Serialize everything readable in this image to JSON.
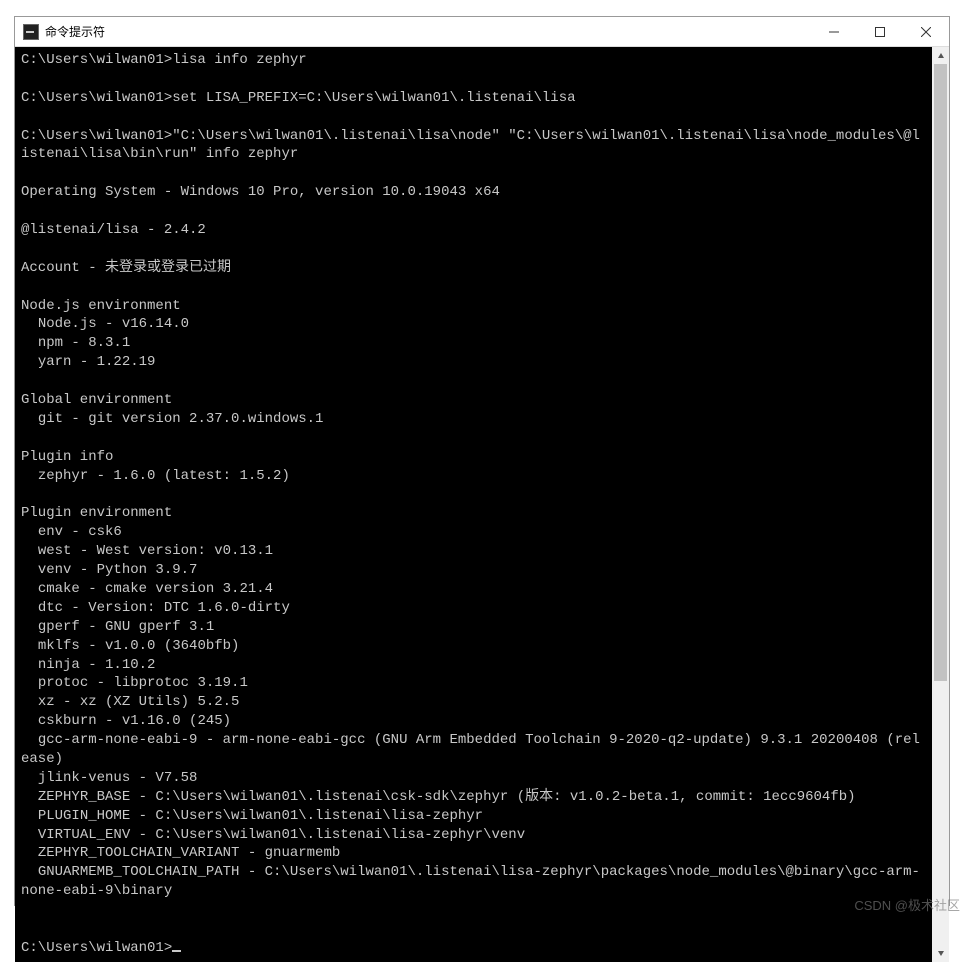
{
  "window": {
    "title": "命令提示符"
  },
  "terminal": {
    "lines": [
      "C:\\Users\\wilwan01>lisa info zephyr",
      "",
      "C:\\Users\\wilwan01>set LISA_PREFIX=C:\\Users\\wilwan01\\.listenai\\lisa",
      "",
      "C:\\Users\\wilwan01>\"C:\\Users\\wilwan01\\.listenai\\lisa\\node\" \"C:\\Users\\wilwan01\\.listenai\\lisa\\node_modules\\@listenai\\lisa\\bin\\run\" info zephyr",
      "",
      "Operating System - Windows 10 Pro, version 10.0.19043 x64",
      "",
      "@listenai/lisa - 2.4.2",
      "",
      "Account - 未登录或登录已过期",
      "",
      "Node.js environment",
      "  Node.js - v16.14.0",
      "  npm - 8.3.1",
      "  yarn - 1.22.19",
      "",
      "Global environment",
      "  git - git version 2.37.0.windows.1",
      "",
      "Plugin info",
      "  zephyr - 1.6.0 (latest: 1.5.2)",
      "",
      "Plugin environment",
      "  env - csk6",
      "  west - West version: v0.13.1",
      "  venv - Python 3.9.7",
      "  cmake - cmake version 3.21.4",
      "  dtc - Version: DTC 1.6.0-dirty",
      "  gperf - GNU gperf 3.1",
      "  mklfs - v1.0.0 (3640bfb)",
      "  ninja - 1.10.2",
      "  protoc - libprotoc 3.19.1",
      "  xz - xz (XZ Utils) 5.2.5",
      "  cskburn - v1.16.0 (245)",
      "  gcc-arm-none-eabi-9 - arm-none-eabi-gcc (GNU Arm Embedded Toolchain 9-2020-q2-update) 9.3.1 20200408 (release)",
      "  jlink-venus - V7.58",
      "  ZEPHYR_BASE - C:\\Users\\wilwan01\\.listenai\\csk-sdk\\zephyr (版本: v1.0.2-beta.1, commit: 1ecc9604fb)",
      "  PLUGIN_HOME - C:\\Users\\wilwan01\\.listenai\\lisa-zephyr",
      "  VIRTUAL_ENV - C:\\Users\\wilwan01\\.listenai\\lisa-zephyr\\venv",
      "  ZEPHYR_TOOLCHAIN_VARIANT - gnuarmemb",
      "  GNUARMEMB_TOOLCHAIN_PATH - C:\\Users\\wilwan01\\.listenai\\lisa-zephyr\\packages\\node_modules\\@binary\\gcc-arm-none-eabi-9\\binary",
      "",
      "",
      "C:\\Users\\wilwan01>"
    ]
  },
  "watermark": "CSDN @极术社区"
}
